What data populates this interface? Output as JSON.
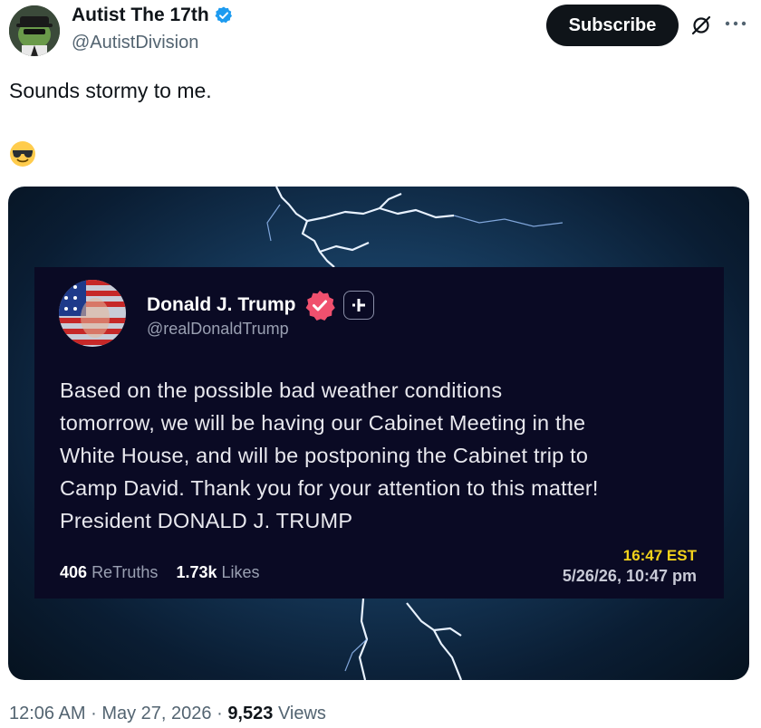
{
  "post": {
    "author_name": "Autist The 17th",
    "author_handle": "@AutistDivision",
    "subscribe_label": "Subscribe",
    "text": "Sounds stormy to me.",
    "emoji": "smiling-face-with-sunglasses",
    "timestamp": "12:06 AM",
    "date": "May 27, 2026",
    "separator": "·",
    "views_count": "9,523",
    "views_label": "Views"
  },
  "embedded_truth": {
    "author_name": "Donald J. Trump",
    "author_handle": "@realDonaldTrump",
    "body_lines": [
      "Based on the possible bad weather conditions",
      "tomorrow, we will be having our Cabinet Meeting in the",
      "White House, and will be postponing the Cabinet trip to",
      "Camp David. Thank you for your attention to this matter!",
      "President DONALD J. TRUMP"
    ],
    "retruths_count": "406",
    "retruths_label": "ReTruths",
    "likes_count": "1.73k",
    "likes_label": "Likes",
    "time": "16:47 EST",
    "datetime": "5/26/26, 10:47 pm"
  },
  "colors": {
    "verified_blue": "#1d9bf0",
    "truth_badge": "#f0506e",
    "time_yellow": "#f2d21b",
    "subscribe_bg": "#0f1419"
  }
}
